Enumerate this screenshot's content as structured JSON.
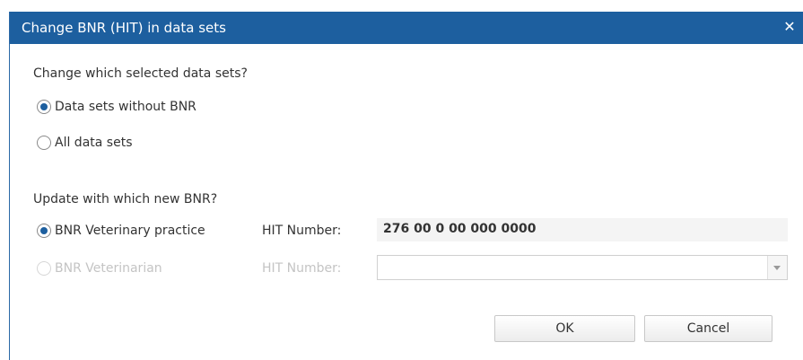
{
  "dialog": {
    "title": "Change BNR (HIT) in data sets",
    "close_glyph": "✕"
  },
  "section_datasets": {
    "question": "Change which selected data sets?",
    "options": [
      {
        "label": "Data sets without BNR",
        "checked": true,
        "disabled": false
      },
      {
        "label": "All data sets",
        "checked": false,
        "disabled": false
      }
    ]
  },
  "section_bnr": {
    "question": "Update with which new BNR?",
    "options": [
      {
        "label": "BNR Veterinary practice",
        "checked": true,
        "disabled": false,
        "hit_label": "HIT Number:",
        "hit_value": "276 00 0 00 000 0000"
      },
      {
        "label": "BNR Veterinarian",
        "checked": false,
        "disabled": true,
        "hit_label": "HIT Number:",
        "hit_value": ""
      }
    ]
  },
  "buttons": {
    "ok": "OK",
    "cancel": "Cancel"
  },
  "colors": {
    "titlebar": "#1d5f9f",
    "accent": "#1d5f9f",
    "disabled_text": "#c4c4c4"
  }
}
